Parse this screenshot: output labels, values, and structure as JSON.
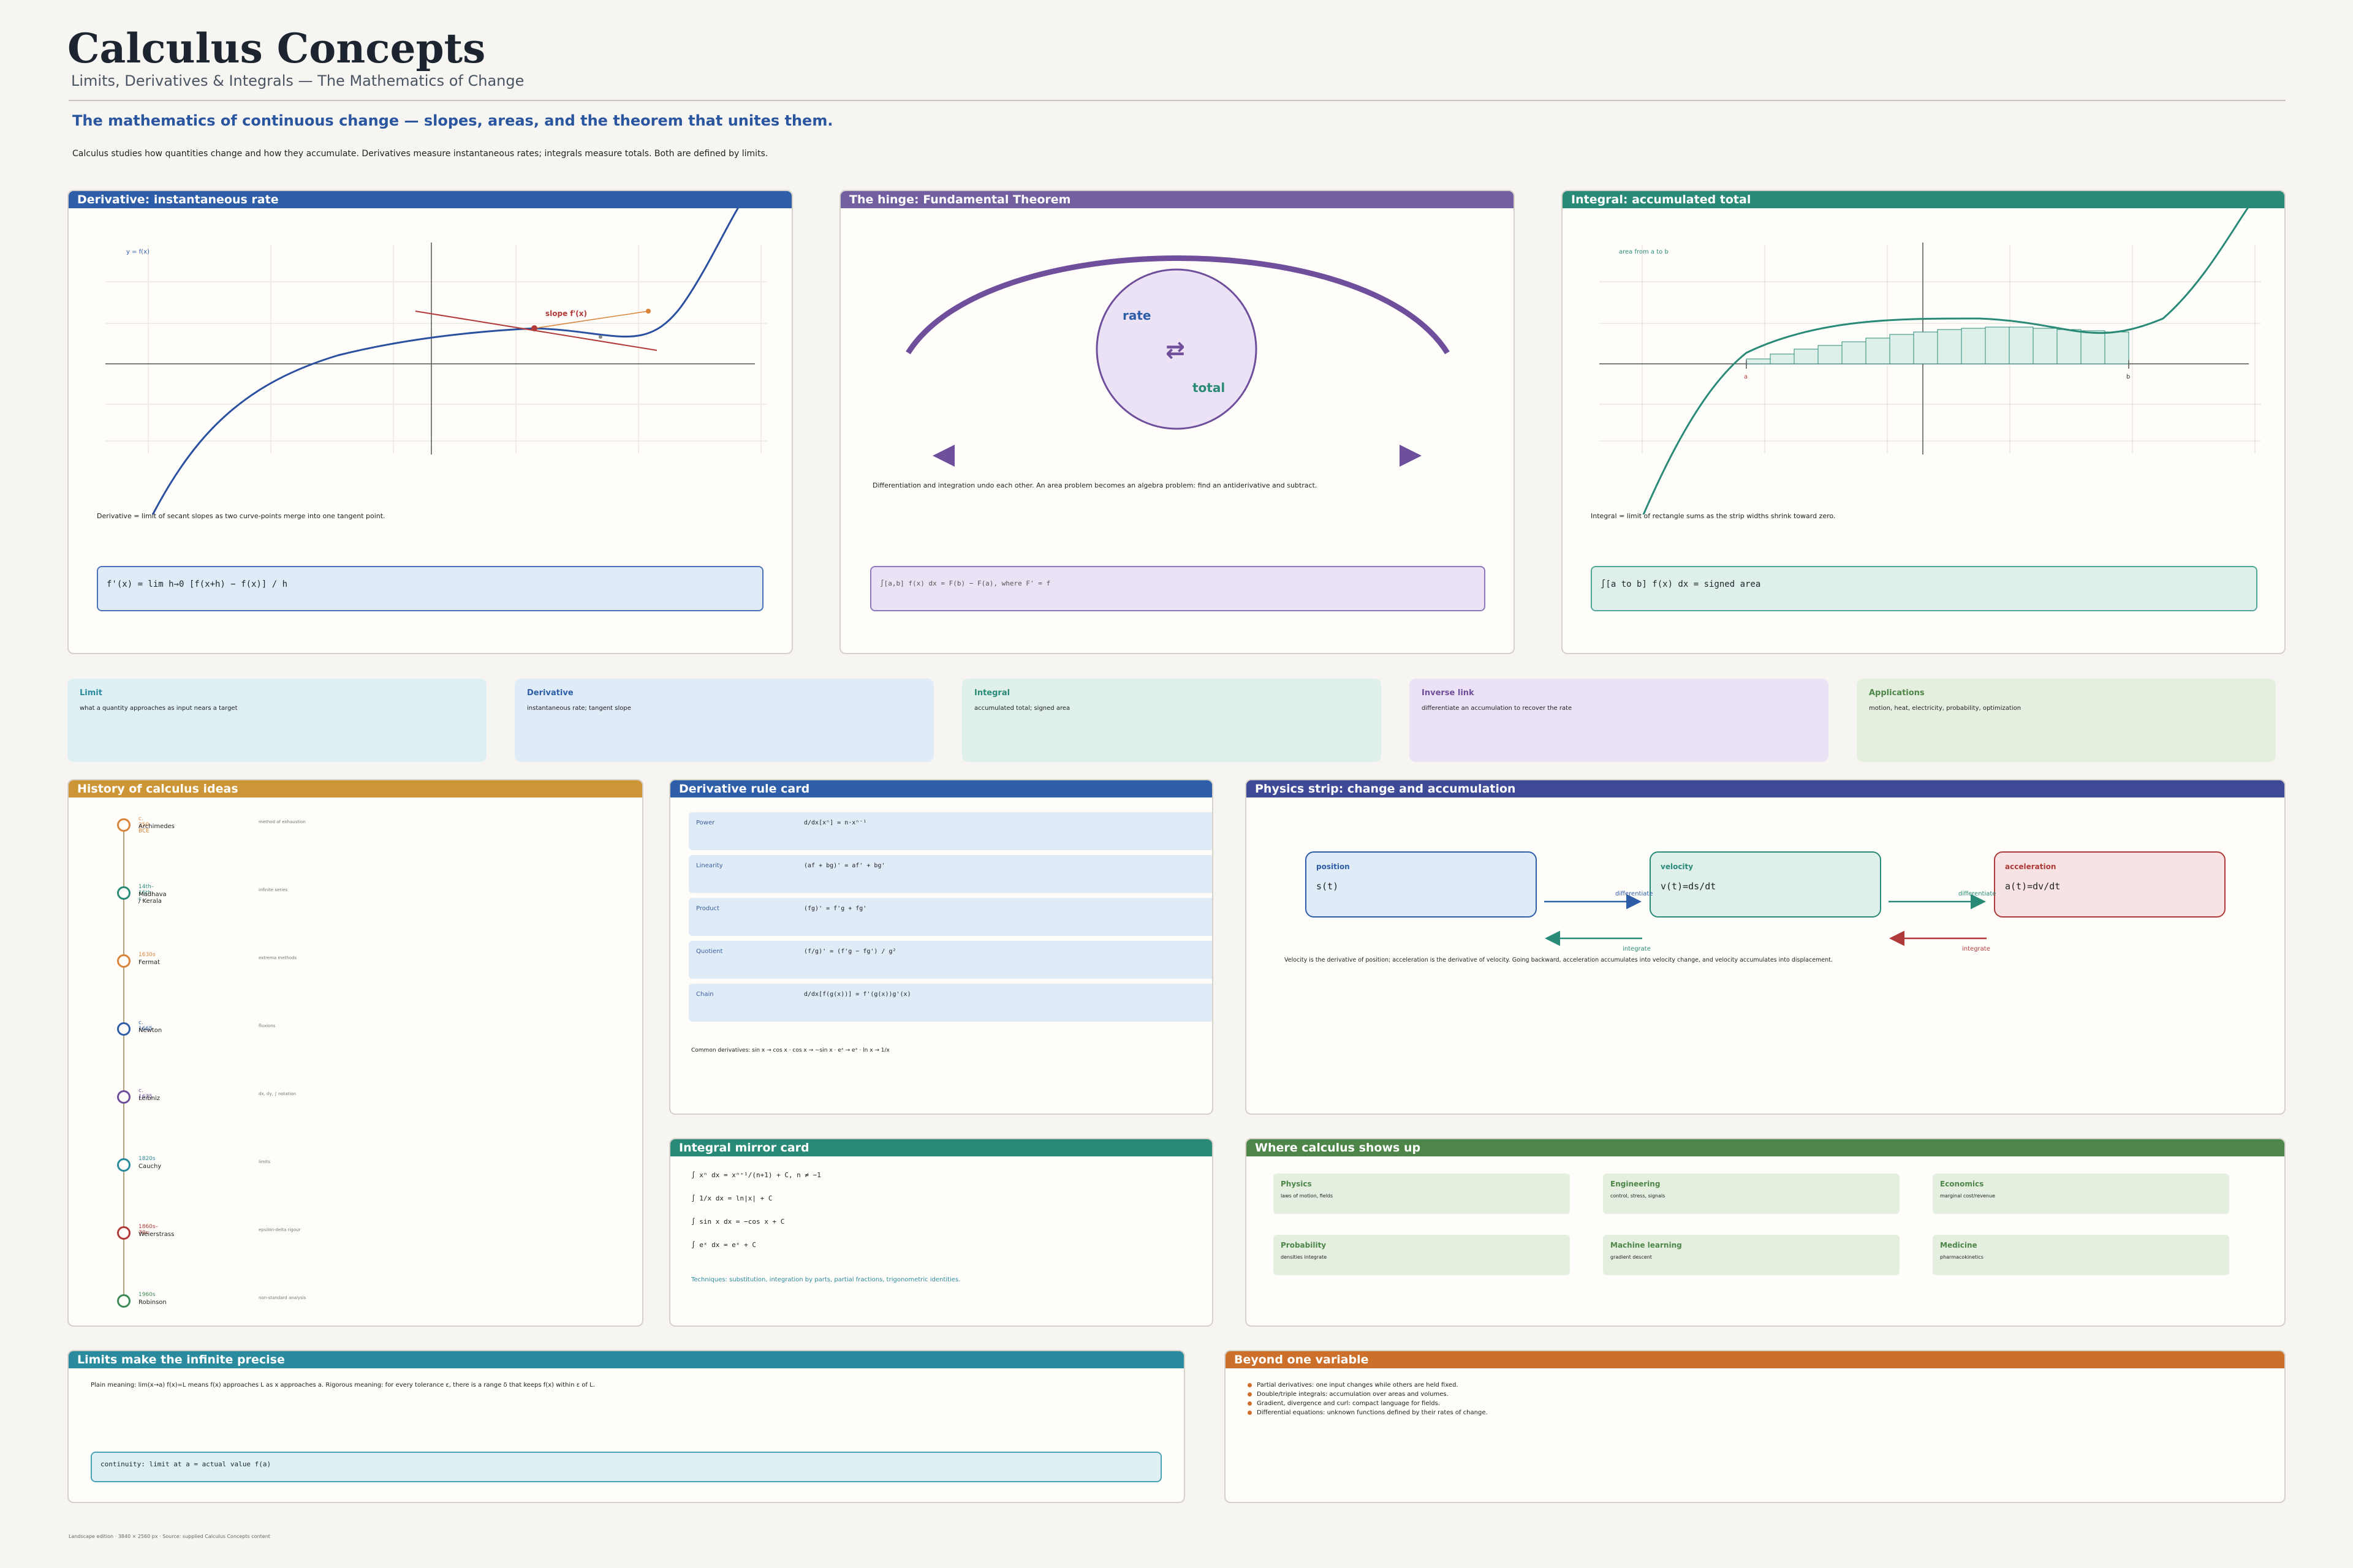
{
  "header": {
    "title": "Calculus Concepts",
    "subtitle": "Limits, Derivatives & Integrals — The Mathematics of Change",
    "tagline": "The mathematics of continuous change — slopes, areas, and the theorem that unites them.",
    "intro": "Calculus studies how quantities change and how they accumulate. Derivatives measure instantaneous rates; integrals measure totals. Both are defined by limits."
  },
  "derivative_panel": {
    "title": "Derivative: instantaneous rate",
    "curve_label": "y = f(x)",
    "slope_label": "slope f'(x)",
    "caption": "Derivative = limit of secant slopes as two curve-points merge into one tangent point.",
    "formula": "f'(x) = lim h→0  [f(x+h) − f(x)] / h",
    "color": "#2e5ea8"
  },
  "ftc_panel": {
    "title": "The hinge: Fundamental Theorem",
    "rate_label": "rate",
    "total_label": "total",
    "swap_icon": "⇄",
    "caption": "Differentiation and integration undo each other. An area problem becomes an algebra problem: find an antiderivative and subtract.",
    "formula": "∫[a,b] f(x) dx = F(b) − F(a),  where F' = f",
    "color": "#6f4e9c"
  },
  "integral_panel": {
    "title": "Integral: accumulated total",
    "area_label": "area from a to b",
    "a_label": "a",
    "b_label": "b",
    "caption": "Integral = limit of rectangle sums as the strip widths shrink toward zero.",
    "formula": "∫[a to b] f(x) dx = signed area",
    "color": "#2a8a78"
  },
  "concepts": [
    {
      "title": "Limit",
      "desc": "what a quantity approaches as input nears a target",
      "bg": "#dff0f5",
      "fg": "#2a8a9e"
    },
    {
      "title": "Derivative",
      "desc": "instantaneous rate; tangent slope",
      "bg": "#e0ebf8",
      "fg": "#2e5ea8"
    },
    {
      "title": "Integral",
      "desc": "accumulated total; signed area",
      "bg": "#dff0ea",
      "fg": "#2a8a78"
    },
    {
      "title": "Inverse link",
      "desc": "differentiate an accumulation to recover the rate",
      "bg": "#ebe3f5",
      "fg": "#6f4e9c"
    },
    {
      "title": "Applications",
      "desc": "motion, heat, electricity, probability, optimization",
      "bg": "#e5efe0",
      "fg": "#4e8548"
    }
  ],
  "history": {
    "title": "History of calculus ideas",
    "color": "#cc9636",
    "items": [
      {
        "date": "c. 250 BCE",
        "name": "Archimedes",
        "note": "method of exhaustion",
        "color": "#d8843a"
      },
      {
        "date": "14th–16th c.",
        "name": "Madhava / Kerala",
        "note": "infinite series",
        "color": "#2a8a78"
      },
      {
        "date": "1630s",
        "name": "Fermat",
        "note": "extrema methods",
        "color": "#d8843a"
      },
      {
        "date": "c. 1665",
        "name": "Newton",
        "note": "fluxions",
        "color": "#2e5ea8"
      },
      {
        "date": "c. 1675",
        "name": "Leibniz",
        "note": "dx, dy, ∫ notation",
        "color": "#6f4e9c"
      },
      {
        "date": "1820s",
        "name": "Cauchy",
        "note": "limits",
        "color": "#2a8a9e"
      },
      {
        "date": "1860s–70s",
        "name": "Weierstrass",
        "note": "epsilon-delta rigour",
        "color": "#b03a3a"
      },
      {
        "date": "1960s",
        "name": "Robinson",
        "note": "non-standard analysis",
        "color": "#3f8a5a"
      }
    ]
  },
  "rules": {
    "title": "Derivative rule card",
    "color": "#2e5ea8",
    "items": [
      {
        "name": "Power",
        "formula": "d/dx[xⁿ] = n·xⁿ⁻¹"
      },
      {
        "name": "Linearity",
        "formula": "(af + bg)' = af' + bg'"
      },
      {
        "name": "Product",
        "formula": "(fg)' = f'g + fg'"
      },
      {
        "name": "Quotient",
        "formula": "(f/g)' = (f'g − fg') / g²"
      },
      {
        "name": "Chain",
        "formula": "d/dx[f(g(x))] = f'(g(x))g'(x)"
      }
    ],
    "footer": "Common derivatives: sin x → cos x · cos x → −sin x · eˣ → eˣ · ln x → 1/x"
  },
  "integrals": {
    "title": "Integral mirror card",
    "color": "#2a8a78",
    "items": [
      "∫ xⁿ dx = xⁿ⁺¹/(n+1) + C,  n ≠ −1",
      "∫ 1/x dx = ln|x| + C",
      "∫ sin x dx = −cos x + C",
      "∫ eˣ dx = eˣ + C"
    ],
    "footer": "Techniques: substitution, integration by parts, partial fractions, trigonometric identities."
  },
  "physics": {
    "title": "Physics strip: change and accumulation",
    "color": "#3e4a96",
    "boxes": [
      {
        "title": "position",
        "formula": "s(t)",
        "fg": "#2e5ea8",
        "bg": "#e0ebf8",
        "border": "#2e5ea8"
      },
      {
        "title": "velocity",
        "formula": "v(t)=ds/dt",
        "fg": "#2a8a78",
        "bg": "#dff0ea",
        "border": "#2a8a78"
      },
      {
        "title": "acceleration",
        "formula": "a(t)=dv/dt",
        "fg": "#b03a3a",
        "bg": "#f7e3e3",
        "border": "#b03a3a"
      }
    ],
    "arrow_top_1": "differentiate",
    "arrow_bottom_1": "integrate",
    "arrow_top_2": "differentiate",
    "arrow_bottom_2": "integrate",
    "caption": "Velocity is the derivative of position; acceleration is the derivative of velocity. Going backward, acceleration accumulates into velocity change, and velocity accumulates into displacement."
  },
  "applications": {
    "title": "Where calculus shows up",
    "color": "#4e8548",
    "items": [
      {
        "title": "Physics",
        "desc": "laws of motion, fields"
      },
      {
        "title": "Engineering",
        "desc": "control, stress, signals"
      },
      {
        "title": "Economics",
        "desc": "marginal cost/revenue"
      },
      {
        "title": "Probability",
        "desc": "densities integrate"
      },
      {
        "title": "Machine learning",
        "desc": "gradient descent"
      },
      {
        "title": "Medicine",
        "desc": "pharmacokinetics"
      }
    ]
  },
  "limits": {
    "title": "Limits make the infinite precise",
    "color": "#2a8a9e",
    "text": "Plain meaning: lim(x→a) f(x)=L means f(x) approaches L as x approaches a. Rigorous meaning: for every tolerance ε, there is a range δ that keeps f(x) within ε of L.",
    "formula": "continuity: limit at a = actual value f(a)"
  },
  "beyond": {
    "title": "Beyond one variable",
    "color": "#cc6f2b",
    "items": [
      "Partial derivatives: one input changes while others are held fixed.",
      "Double/triple integrals: accumulation over areas and volumes.",
      "Gradient, divergence and curl: compact language for fields.",
      "Differential equations: unknown functions defined by their rates of change."
    ]
  },
  "footer": "Landscape edition · 3840 × 2560 px · Source: supplied Calculus Concepts content"
}
